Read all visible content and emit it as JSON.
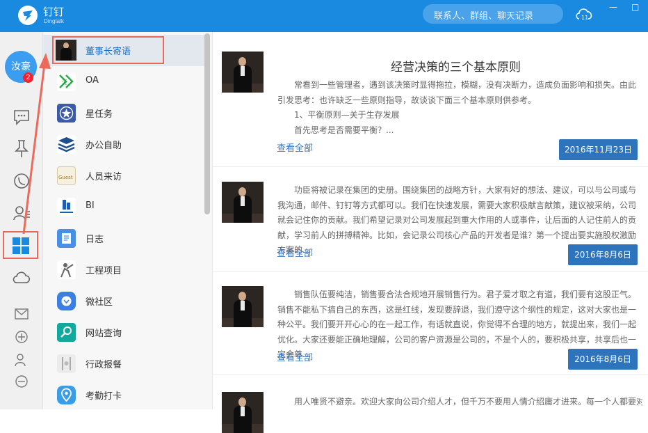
{
  "header": {
    "brand_name": "钉钉",
    "brand_sub": "Dingtalk",
    "search_placeholder": "联系人、群组、聊天记录",
    "min_label": "—",
    "close_label": "□"
  },
  "leftnav": {
    "avatar_text": "汝豪",
    "chat_badge": "2"
  },
  "apps": [
    {
      "label": "董事长寄语",
      "icon": "chairman-photo-icon"
    },
    {
      "label": "OA",
      "icon": "fanwei-logo-icon"
    },
    {
      "label": "星任务",
      "icon": "star-icon"
    },
    {
      "label": "办公自助",
      "icon": "stack-icon"
    },
    {
      "label": "人员来访",
      "icon": "guest-icon"
    },
    {
      "label": "BI",
      "icon": "bi-logo-icon"
    },
    {
      "label": "日志",
      "icon": "note-icon"
    },
    {
      "label": "工程项目",
      "icon": "worker-icon"
    },
    {
      "label": "微社区",
      "icon": "community-icon"
    },
    {
      "label": "网站查询",
      "icon": "magnifier-icon"
    },
    {
      "label": "行政报餐",
      "icon": "meal-icon"
    },
    {
      "label": "考勤打卡",
      "icon": "location-pin-icon"
    }
  ],
  "articles": [
    {
      "title": "经营决策的三个基本原则",
      "lines": [
        "常看到一些管理者，遇到该决策时显得拖拉，模糊，没有决断力，造成负面影响和损失。由此引发思考：也许缺乏一些原则指导，故谈谈下面三个基本原则供参考。",
        "1、平衡原则—关于生存发展",
        "首先思考是否需要平衡？..."
      ],
      "more": "查看全部",
      "date": "2016年11月23日"
    },
    {
      "title": "",
      "lines": [
        "功臣将被记录在集团的史册。围绕集团的战略方针，大家有好的想法、建议，可以与公司或与我沟通，邮件、钉钉等方式都可以。我们在快速发展，需要大家积极献言献策，建议被采纳，公司就会记住你的贡献。我们希望记录对公司发展起到重大作用的人或事件，让后面的人记住前人的贡献，学习前人的拼搏精神。比如，会记录公司核心产品的开发者是谁？第一个提出要实施股权激励方案的..."
      ],
      "more": "查看全部",
      "date": "2016年8月6日"
    },
    {
      "title": "",
      "lines": [
        "销售队伍要纯洁，销售要合法合规地开展销售行为。君子爱才取之有道，我们要有这股正气。销售不能私下搞自己的东西，这是红线，发现要辞退，我们遵守这个纲性的规定，这对大家也是一种公平。我们要开开心心的在一起工作，有话就直说，你觉得不合理的地方，就提出来，我们一起优化。大家还要能正确地理解，公司的客户资源是公司的，不是个人的，要积极共享，共享后也一定会尊..."
      ],
      "more": "查看全部",
      "date": "2016年8月6日"
    },
    {
      "title": "",
      "lines": [
        "用人唯贤不避亲。欢迎大家向公司介绍人才，但千万不要用人情介绍庸才进来。每一个人都要对"
      ],
      "more": "",
      "date": ""
    }
  ],
  "colors": {
    "topbar": "#1a8ae0",
    "date_button": "#2e74bd",
    "highlight": "#ec6a5c",
    "badge": "#f5222d"
  }
}
